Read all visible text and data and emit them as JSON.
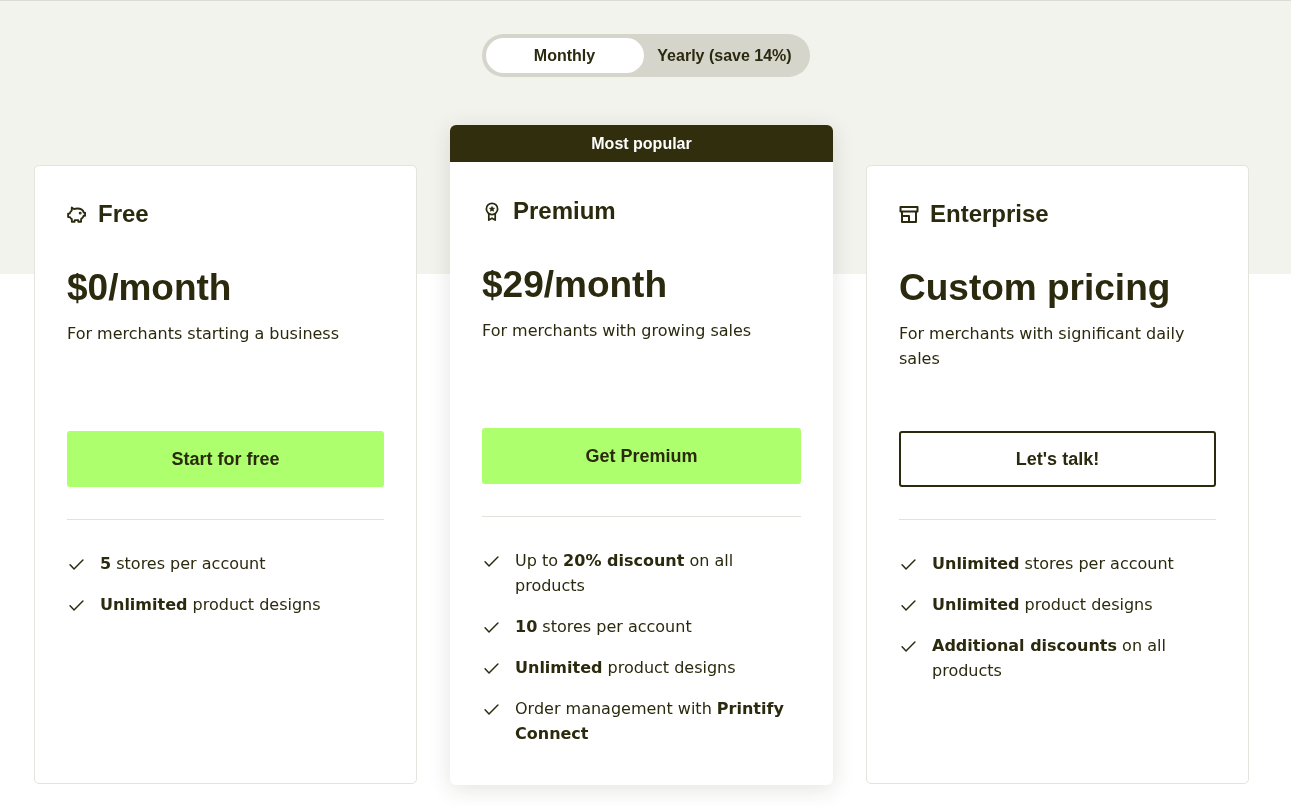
{
  "billing_toggle": {
    "options": [
      {
        "label": "Monthly",
        "selected": true
      },
      {
        "label": "Yearly (save 14%)",
        "selected": false
      }
    ]
  },
  "plans": [
    {
      "name": "Free",
      "price": "$0/month",
      "description": "For merchants starting a business",
      "button": {
        "label": "Start for free",
        "kind": "filled"
      },
      "features": [
        "**5** stores per account",
        "**Unlimited** product designs"
      ]
    },
    {
      "badge": "Most popular",
      "name": "Premium",
      "price": "$29/month",
      "description": "For merchants with growing sales",
      "button": {
        "label": "Get Premium",
        "kind": "filled"
      },
      "features": [
        "Up to **20% discount** on all products",
        "**10** stores per account",
        "**Unlimited** product designs",
        "Order management with **Printify Connect**"
      ]
    },
    {
      "name": "Enterprise",
      "price": "Custom pricing",
      "description": "For merchants with significant daily sales",
      "button": {
        "label": "Let's talk!",
        "kind": "outline"
      },
      "features": [
        "**Unlimited** stores per account",
        "**Unlimited** product designs",
        "**Additional discounts** on all products"
      ]
    }
  ]
}
